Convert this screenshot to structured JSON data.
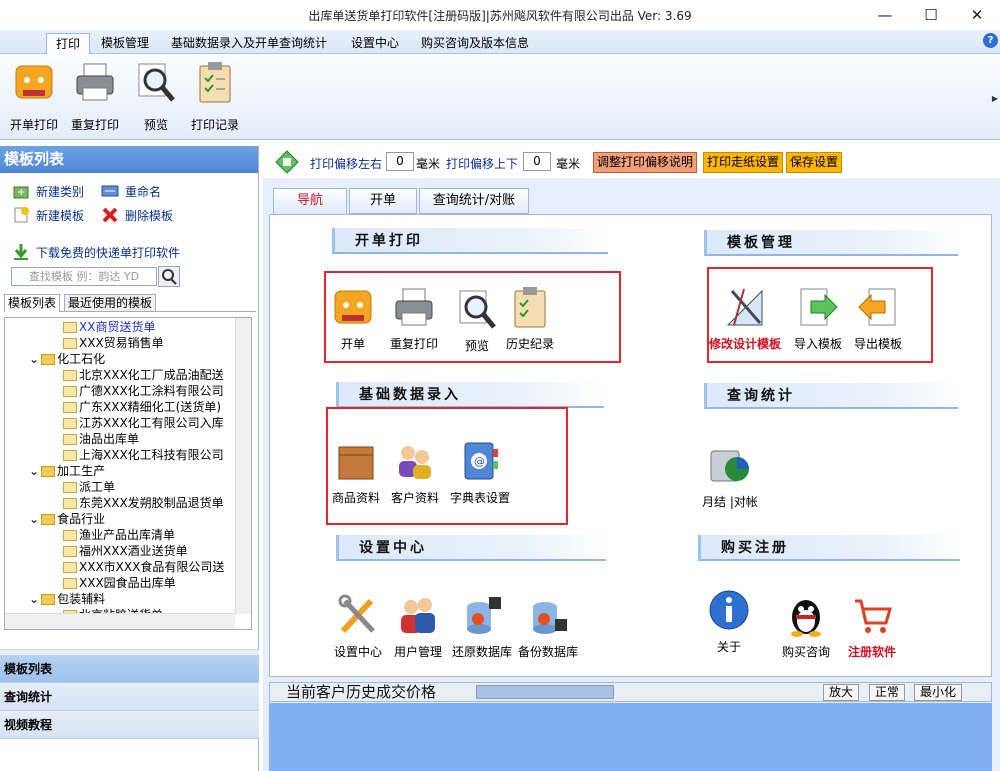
{
  "window": {
    "title": "出库单送货单打印软件[注册码版]|苏州飚风软件有限公司出品  Ver: 3.69"
  },
  "menu": {
    "tabs": [
      "打印",
      "模板管理",
      "基础数据录入及开单查询统计",
      "设置中心",
      "购买咨询及版本信息"
    ]
  },
  "ribbon": {
    "buttons": [
      "开单打印",
      "重复打印",
      "预览",
      "打印记录"
    ]
  },
  "sidebar": {
    "title": "模板列表",
    "actions": {
      "new_category": "新建类别",
      "rename": "重命名",
      "new_template": "新建模板",
      "delete_template": "删除模板",
      "download": "下载免费的快递单打印软件"
    },
    "search_placeholder": "查找模板 例：韵达 YD",
    "tabs": [
      "模板列表",
      "最近使用的模板"
    ],
    "tree": [
      {
        "text": "XX商贸送货单",
        "level": 2,
        "type": "file",
        "selected": true
      },
      {
        "text": "XXX贸易销售单",
        "level": 2,
        "type": "file"
      },
      {
        "text": "化工石化",
        "level": 1,
        "type": "folder"
      },
      {
        "text": "北京XXX化工厂成品油配送",
        "level": 2,
        "type": "file"
      },
      {
        "text": "广德XXX化工涂料有限公司",
        "level": 2,
        "type": "file"
      },
      {
        "text": "广东XXX精细化工(送货单)",
        "level": 2,
        "type": "file"
      },
      {
        "text": "江苏XXX化工有限公司入库",
        "level": 2,
        "type": "file"
      },
      {
        "text": "油品出库单",
        "level": 2,
        "type": "file"
      },
      {
        "text": "上海XXX化工科技有限公司",
        "level": 2,
        "type": "file"
      },
      {
        "text": "加工生产",
        "level": 1,
        "type": "folder"
      },
      {
        "text": "派工单",
        "level": 2,
        "type": "file"
      },
      {
        "text": "东莞XXX发朔胶制品退货单",
        "level": 2,
        "type": "file"
      },
      {
        "text": "食品行业",
        "level": 1,
        "type": "folder"
      },
      {
        "text": "渔业产品出库清单",
        "level": 2,
        "type": "file"
      },
      {
        "text": "福州XXX酒业送货单",
        "level": 2,
        "type": "file"
      },
      {
        "text": "XXX市XXX食品有限公司送",
        "level": 2,
        "type": "file"
      },
      {
        "text": "XXX园食品出库单",
        "level": 2,
        "type": "file"
      },
      {
        "text": "包装辅料",
        "level": 1,
        "type": "folder"
      },
      {
        "text": "北京粘胶送货单",
        "level": 2,
        "type": "file"
      }
    ],
    "nav": [
      "模板列表",
      "查询统计",
      "视频教程"
    ]
  },
  "toolbar": {
    "offset_lr_label": "打印偏移左右",
    "offset_lr_value": "0",
    "offset_ud_label": "打印偏移上下",
    "offset_ud_value": "0",
    "unit": "毫米",
    "btn_adjust": "调整打印偏移说明",
    "btn_paper": "打印走纸设置",
    "btn_save": "保存设置"
  },
  "content_tabs": [
    "导航",
    "开单",
    "查询统计/对账"
  ],
  "sections": {
    "print": {
      "title": "开单打印",
      "items": [
        "开单",
        "重复打印",
        "预览",
        "历史纪录"
      ]
    },
    "template": {
      "title": "模板管理",
      "items": [
        "修改设计模板",
        "导入模板",
        "导出模板"
      ]
    },
    "basic": {
      "title": "基础数据录入",
      "items": [
        "商品资料",
        "客户资料",
        "字典表设置"
      ]
    },
    "query": {
      "title": "查询统计",
      "items": [
        "月结 |对帐"
      ]
    },
    "settings": {
      "title": "设置中心",
      "items": [
        "设置中心",
        "用户管理",
        "还原数据库",
        "备份数据库"
      ]
    },
    "buy": {
      "title": "购买注册",
      "items": [
        "关于",
        "购买咨询",
        "注册软件"
      ]
    }
  },
  "status": {
    "label": "当前客户历史成交价格",
    "buttons": [
      "放大",
      "正常",
      "最小化"
    ]
  },
  "colors": {
    "highlight_red": "#e0282e",
    "accent_blue": "#4c86d1",
    "orange_btn": "#ffb400",
    "bottom_panel": "#7fb0ef"
  }
}
